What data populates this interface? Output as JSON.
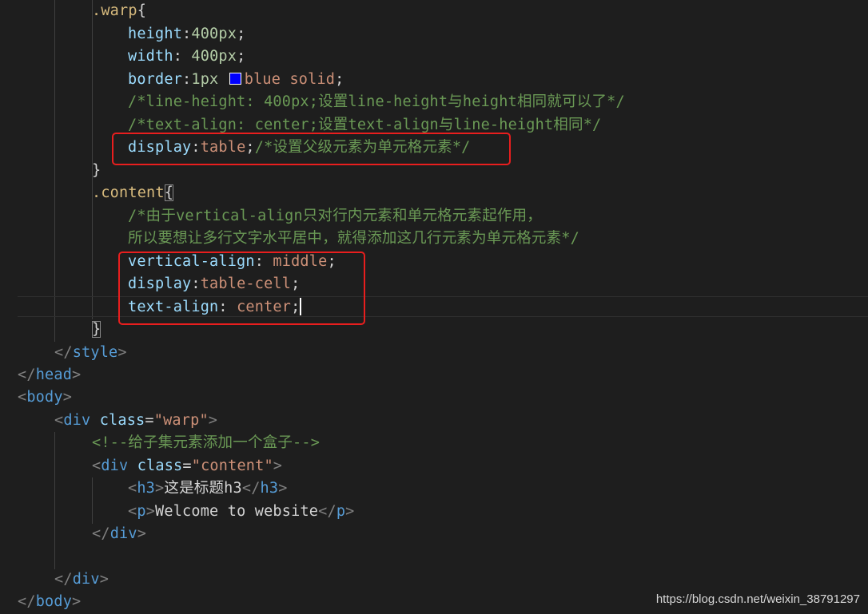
{
  "colors": {
    "background": "#1e1e1e",
    "selector": "#d7ba7d",
    "property": "#9cdcfe",
    "number": "#b5cea8",
    "string": "#ce9178",
    "comment": "#6a9955",
    "tag": "#569cd6",
    "highlight_box": "#e81e1e"
  },
  "code": {
    "warp_selector": ".warp",
    "open_brace": "{",
    "close_brace": "}",
    "height_prop": "height",
    "height_val": "400px",
    "width_prop": "width",
    "width_val": "400px",
    "border_prop": "border",
    "border_width": "1px",
    "border_color": "blue",
    "border_style": "solid",
    "comment_line_height": "/*line-height: 400px;设置line-height与height相同就可以了*/",
    "comment_text_align": "/*text-align: center;设置text-align与line-height相同*/",
    "display_prop": "display",
    "display_table_val": "table",
    "comment_display_table": "/*设置父级元素为单元格元素*/",
    "content_selector": ".content",
    "comment_vertical_1": "/*由于vertical-align只对行内元素和单元格元素起作用，",
    "comment_vertical_2": "所以要想让多行文字水平居中，就得添加这几行元素为单元格元素*/",
    "vertical_align_prop": "vertical-align",
    "vertical_align_val": "middle",
    "display_cell_val": "table-cell",
    "text_align_prop": "text-align",
    "text_align_val": "center",
    "style_tag": "style",
    "head_tag": "head",
    "body_tag": "body",
    "div_tag": "div",
    "class_attr": "class",
    "warp_class_value": "\"warp\"",
    "html_comment": "<!--给子集元素添加一个盒子-->",
    "content_class_value": "\"content\"",
    "h3_tag": "h3",
    "h3_text": "这是标题h3",
    "p_tag": "p",
    "p_text": "Welcome to website"
  },
  "watermark": "https://blog.csdn.net/weixin_38791297"
}
